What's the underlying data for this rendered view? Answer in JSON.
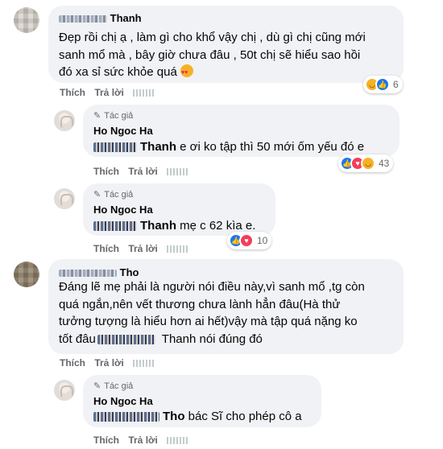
{
  "comments": [
    {
      "author": "Thanh",
      "text_lines": [
        "Đẹp rồi chị ạ , làm gì cho khổ vậy chị , dù gì chị cũng mới",
        "sanh mổ mà , bây giờ chưa đâu , 50t chị sẽ hiểu sao hồi",
        "đó xa sỉ sức khỏe quá"
      ],
      "actions": {
        "like": "Thích",
        "reply": "Trả lời"
      },
      "reaction_count": "6"
    },
    {
      "badge": "Tác giả",
      "author": "Ho Ngoc Ha",
      "mention": "Thanh",
      "text": "e ơi ko tập thì 50 mới ốm yếu đó e",
      "actions": {
        "like": "Thích",
        "reply": "Trả lời"
      },
      "reaction_count": "43"
    },
    {
      "badge": "Tác giả",
      "author": "Ho Ngoc Ha",
      "mention": "Thanh",
      "text": "mẹ c 62 kìa e.",
      "actions": {
        "like": "Thích",
        "reply": "Trả lời"
      },
      "reaction_count": "10"
    },
    {
      "author": "Tho",
      "text_lines": [
        "Đáng lẽ mẹ phải là người nói điều này,vì sanh mổ ,tg còn",
        "quá ngắn,nên vết thương chưa lành hẳn đâu(Hà thử",
        "tưởng tượng là hiểu hơn ai hết)vậy mà tập quá nặng ko",
        "tốt đâu"
      ],
      "mention_tail": "Thanh nói đúng đó",
      "actions": {
        "like": "Thích",
        "reply": "Trả lời"
      }
    },
    {
      "badge": "Tác giả",
      "author": "Ho Ngoc Ha",
      "mention": "Tho",
      "text": "bác Sĩ cho phép cô a",
      "actions": {
        "like": "Thích",
        "reply": "Trả lời"
      }
    }
  ],
  "colors": {
    "like": "#1877f2",
    "love": "#f33e58",
    "haha": "#f7b125",
    "bubble": "#f0f2f5"
  }
}
